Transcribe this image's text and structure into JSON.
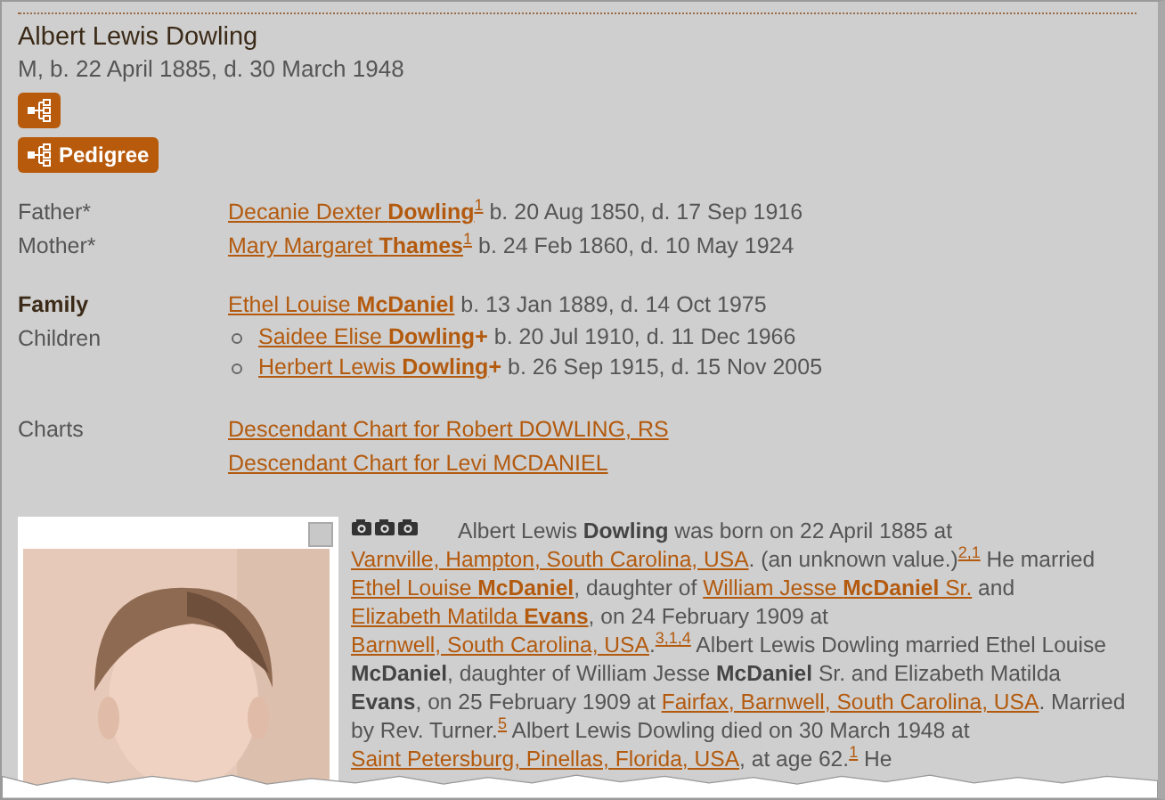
{
  "person": {
    "name": "Albert Lewis Dowling",
    "summary": "M, b. 22 April 1885, d. 30 March 1948"
  },
  "buttons": [
    {
      "kind": "icon"
    },
    {
      "kind": "icon_label",
      "label": "Pedigree"
    }
  ],
  "parents": [
    {
      "label": "Father*",
      "name": "Decanie Dexter **Dowling**",
      "note": "1",
      "dates": "b. 20 Aug 1850, d. 17 Sep 1916"
    },
    {
      "label": "Mother*",
      "name": "Mary Margaret **Thames**",
      "note": "1",
      "dates": "b. 24 Feb 1860, d. 10 May 1924"
    }
  ],
  "family": {
    "label": "Family",
    "spouse": "Ethel Louise **McDaniel**",
    "dates": "b. 13 Jan 1889, d. 14 Oct 1975"
  },
  "children": {
    "label": "Children",
    "items": [
      {
        "name": "Saidee Elise **Dowling**",
        "marker": "+",
        "dates": "b. 20 Jul 1910, d. 11 Dec 1966"
      },
      {
        "name": "Herbert Lewis **Dowling**",
        "marker": "+",
        "dates": "b. 26 Sep 1915, d. 15 Nov 2005"
      }
    ]
  },
  "charts": {
    "label": "Charts",
    "links": [
      "Descendant Chart for Robert DOWLING, RS",
      "Descendant Chart for Levi MCDANIEL"
    ]
  },
  "narrative": [
    {
      "kind": "text",
      "text": "Albert Lewis **Dowling** was born on 22 April 1885 at "
    },
    {
      "kind": "place",
      "text": "Varnville, Hampton, South Carolina, USA"
    },
    {
      "kind": "text",
      "text": ". (an unknown value.)"
    },
    {
      "kind": "note",
      "text": "2,1"
    },
    {
      "kind": "text",
      "text": " He married "
    },
    {
      "kind": "person",
      "text": "Ethel Louise **McDaniel**"
    },
    {
      "kind": "text",
      "text": ", daughter of "
    },
    {
      "kind": "person",
      "text": "William Jesse **McDaniel** Sr."
    },
    {
      "kind": "text",
      "text": " and "
    },
    {
      "kind": "person",
      "text": "Elizabeth Matilda **Evans**"
    },
    {
      "kind": "text",
      "text": ", on 24 February 1909 at "
    },
    {
      "kind": "place",
      "text": "Barnwell, South Carolina, USA"
    },
    {
      "kind": "text",
      "text": "."
    },
    {
      "kind": "note",
      "text": "3,1,4"
    },
    {
      "kind": "text",
      "text": " Albert Lewis Dowling married Ethel Louise **McDaniel**, daughter of William Jesse **McDaniel** Sr. and Elizabeth Matilda **Evans**, on 25 February 1909 at "
    },
    {
      "kind": "place",
      "text": "Fairfax, Barnwell, South Carolina, USA"
    },
    {
      "kind": "text",
      "text": ". Married by Rev. Turner."
    },
    {
      "kind": "note",
      "text": "5"
    },
    {
      "kind": "text",
      "text": " Albert Lewis Dowling died on 30 March 1948 at "
    },
    {
      "kind": "place",
      "text": "Saint Petersburg, Pinellas, Florida, USA"
    },
    {
      "kind": "text",
      "text": ", at age 62."
    },
    {
      "kind": "note",
      "text": "1"
    },
    {
      "kind": "text",
      "text": " He"
    }
  ]
}
